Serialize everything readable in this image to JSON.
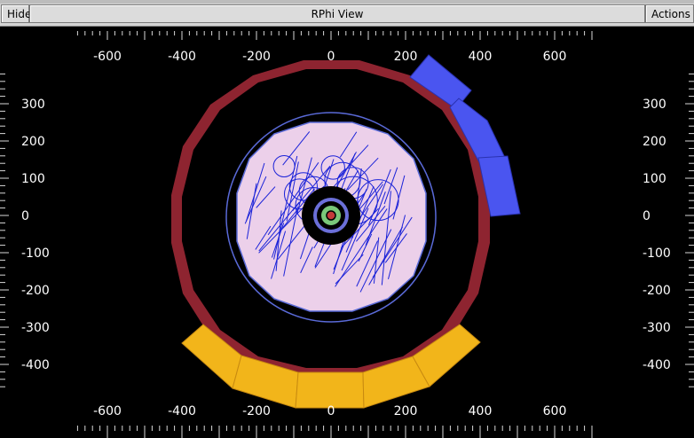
{
  "window": {
    "hide_label": "Hide",
    "title": "RPhi View",
    "actions_label": "Actions"
  },
  "axes": {
    "x_ticks": [
      "-600",
      "-400",
      "-200",
      "0",
      "200",
      "400",
      "600"
    ],
    "x_values": [
      -600,
      -400,
      -200,
      0,
      200,
      400,
      600
    ],
    "y_ticks": [
      "300",
      "200",
      "100",
      "0",
      "-100",
      "-200",
      "-300",
      "-400"
    ],
    "y_values": [
      300,
      200,
      100,
      0,
      -100,
      -200,
      -300,
      -400
    ]
  },
  "colors": {
    "background": "#000000",
    "muon_ring": "#8e2430",
    "calo_tower_hits": "#4a55f0",
    "yellow_towers": "#f2b51a",
    "tracks": "#1a22d8",
    "tracker_fill": "#ecd0ea",
    "outline": "#5a6ad8",
    "beampipe": "#7ac87a"
  }
}
